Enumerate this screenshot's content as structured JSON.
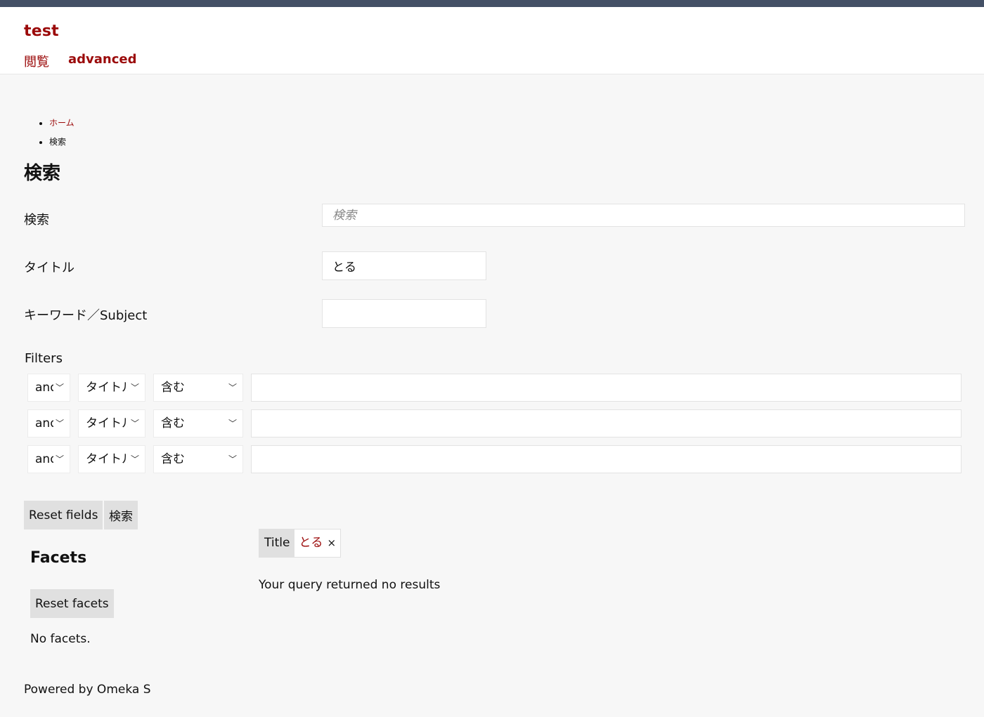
{
  "header": {
    "site_title": "test",
    "nav": [
      {
        "label": "閲覧"
      },
      {
        "label": "advanced"
      }
    ]
  },
  "breadcrumbs": [
    {
      "label": "ホーム",
      "link": true
    },
    {
      "label": "検索",
      "link": false
    }
  ],
  "page_title": "検索",
  "form": {
    "search": {
      "label": "検索",
      "placeholder": "検索",
      "value": ""
    },
    "title": {
      "label": "タイトル",
      "value": "とる"
    },
    "keyword": {
      "label": "キーワード／Subject",
      "value": ""
    },
    "filters_label": "Filters",
    "filters": [
      {
        "join": "and",
        "field": "タイトル",
        "type": "含む",
        "value": ""
      },
      {
        "join": "and",
        "field": "タイトル",
        "type": "含む",
        "value": ""
      },
      {
        "join": "and",
        "field": "タイトル",
        "type": "含む",
        "value": ""
      }
    ],
    "reset_label": "Reset fields",
    "submit_label": "検索"
  },
  "facets": {
    "title": "Facets",
    "reset_label": "Reset facets",
    "empty_text": "No facets."
  },
  "active_filter": {
    "label": "Title",
    "value": "とる",
    "remove": "×"
  },
  "results": {
    "empty_text": "Your query returned no results"
  },
  "footer": {
    "text": "Powered by Omeka S"
  },
  "colors": {
    "accent": "#9b0a0a",
    "topbar": "#445066",
    "background": "#f7f7f7",
    "button": "#e0e0e0"
  }
}
